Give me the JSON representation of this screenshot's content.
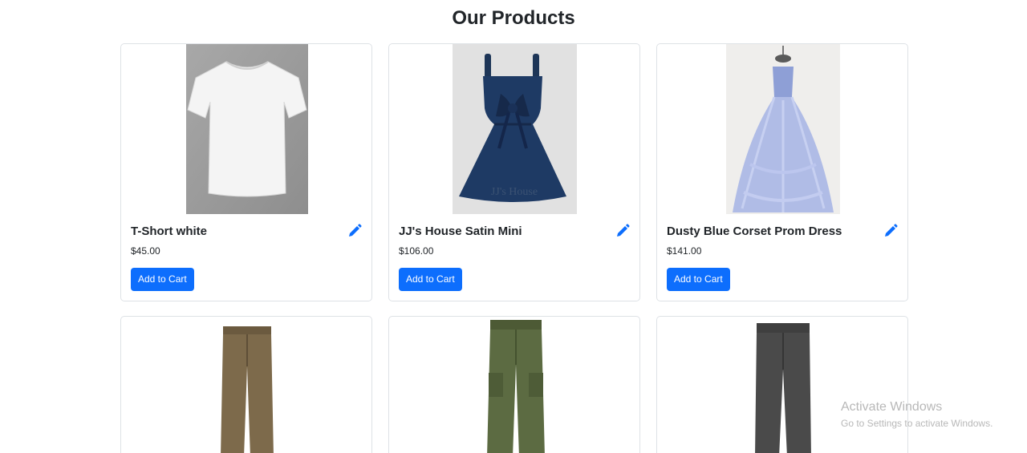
{
  "page": {
    "title": "Our Products"
  },
  "colors": {
    "primary": "#0d6efd",
    "card_border": "#dee2e6"
  },
  "products": [
    {
      "name": "T-Short white",
      "price": "$45.00",
      "cart_label": "Add to Cart",
      "image": "white-tshirt"
    },
    {
      "name": "JJ's House Satin Mini",
      "price": "$106.00",
      "cart_label": "Add to Cart",
      "image": "navy-satin-dress",
      "image_text": "JJ's House"
    },
    {
      "name": "Dusty Blue Corset Prom Dress",
      "price": "$141.00",
      "cart_label": "Add to Cart",
      "image": "blue-prom-dress"
    },
    {
      "image": "brown-trousers"
    },
    {
      "image": "olive-cargo-pants"
    },
    {
      "image": "grey-trousers"
    }
  ],
  "watermark": {
    "line1": "Activate Windows",
    "line2": "Go to Settings to activate Windows."
  }
}
